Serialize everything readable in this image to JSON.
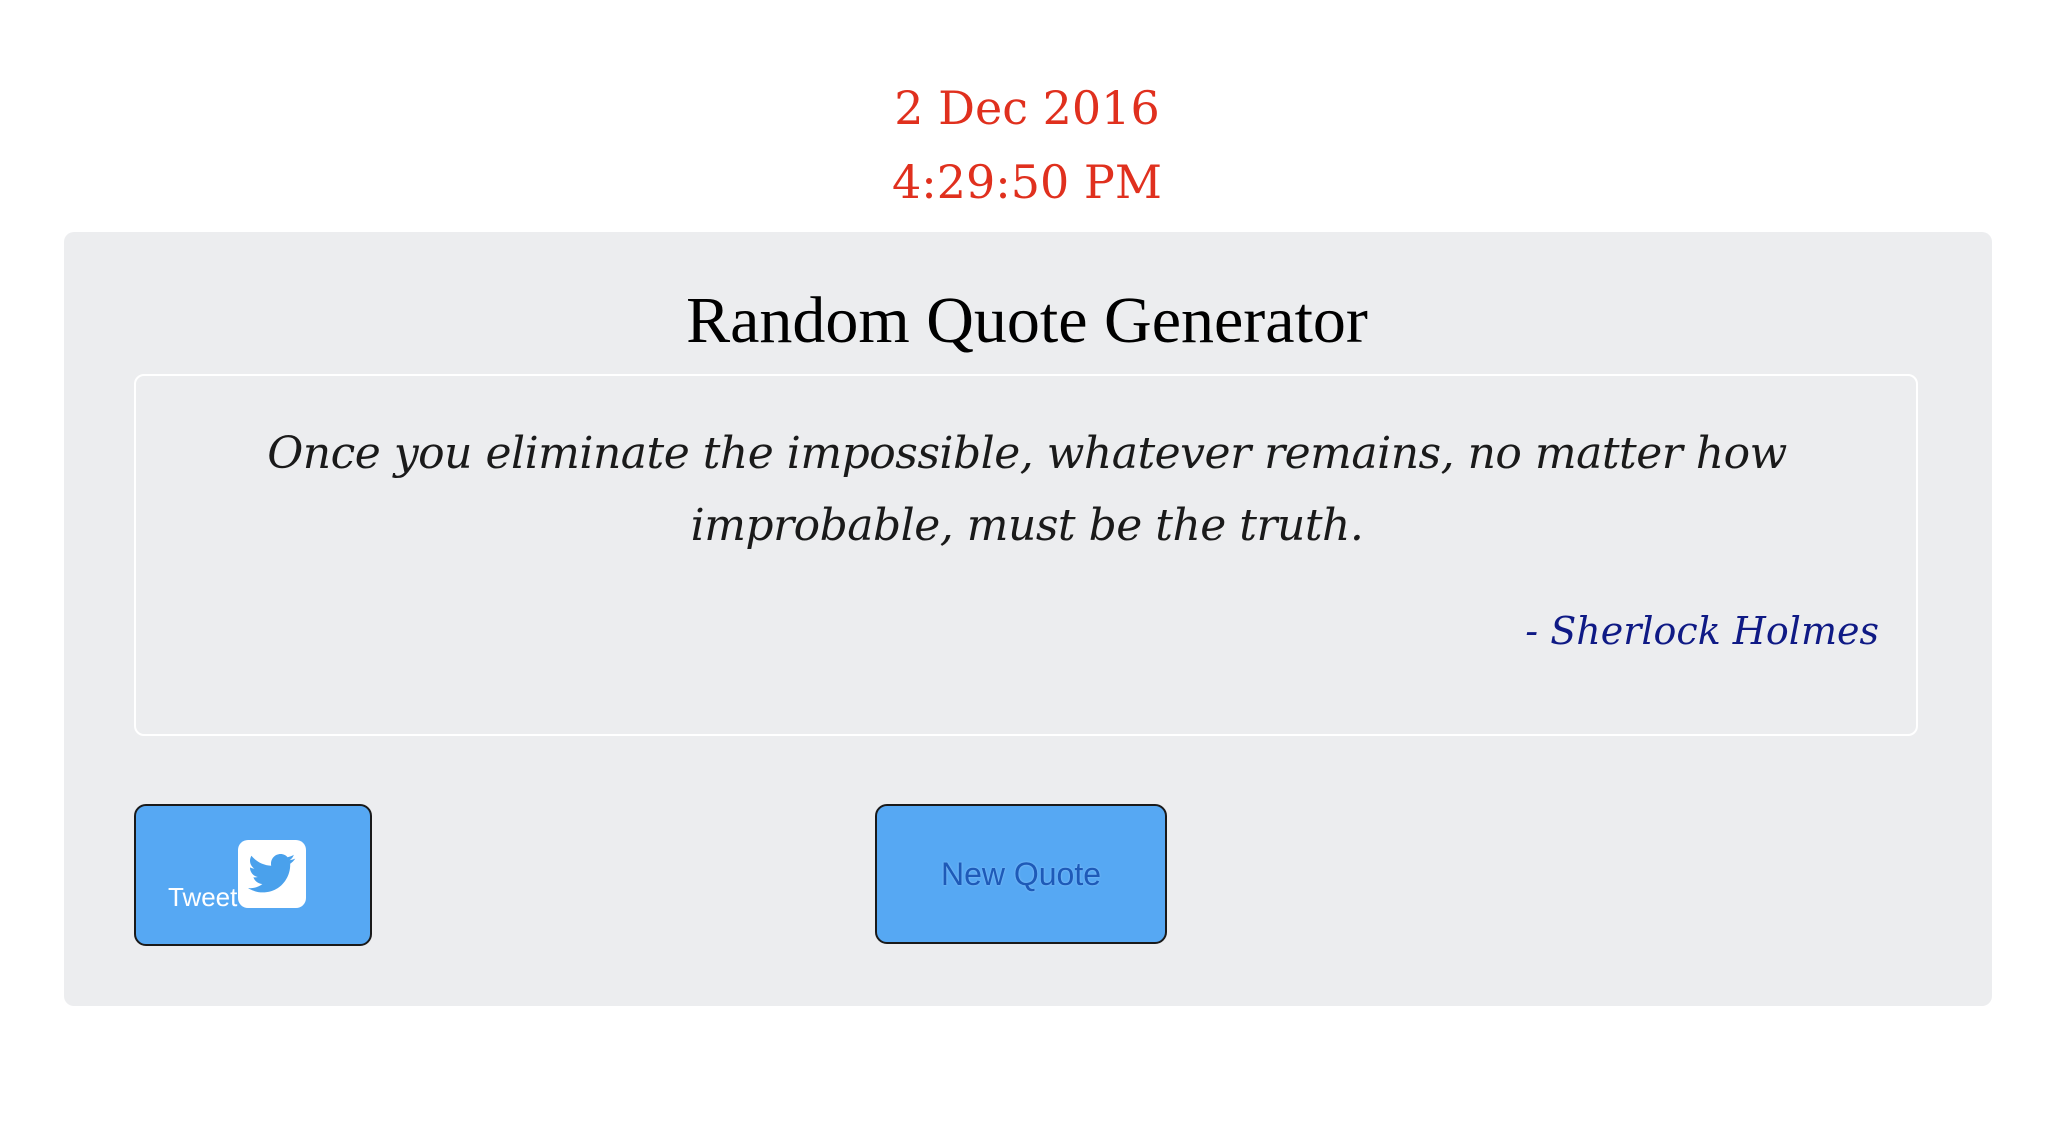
{
  "datetime": {
    "date": "2 Dec 2016",
    "time": "4:29:50 PM"
  },
  "card": {
    "title": "Random Quote Generator",
    "quote": "Once you eliminate the impossible, whatever remains, no matter how improbable, must be the truth.",
    "author": "- Sherlock Holmes"
  },
  "buttons": {
    "tweet_label": "Tweet",
    "tweet_icon": "twitter-bird-icon",
    "new_quote_label": "New Quote"
  },
  "colors": {
    "datetime": "#e0301e",
    "card_background": "#ecedef",
    "author": "#0f1a85",
    "button": "#56a8f3"
  }
}
